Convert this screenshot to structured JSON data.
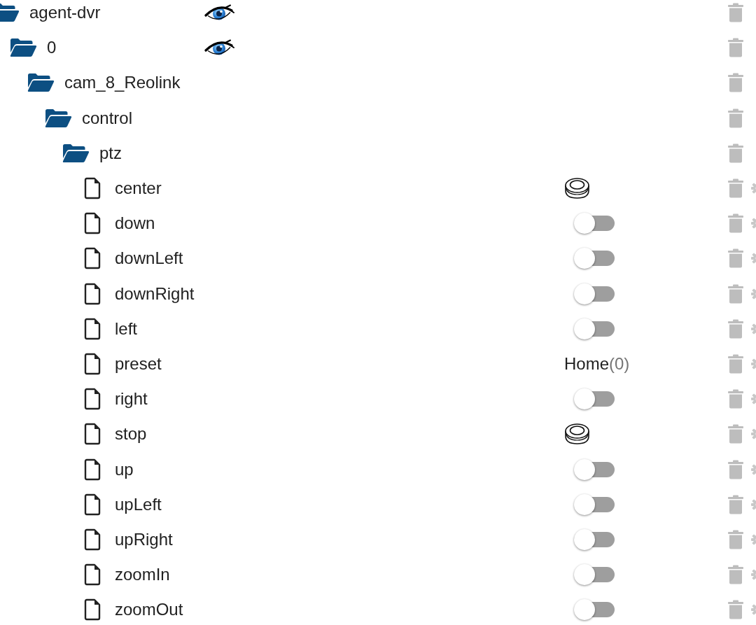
{
  "tree": [
    {
      "kind": "folder",
      "name": "agent-dvr",
      "expanded": true,
      "watched": true,
      "children": [
        {
          "kind": "folder",
          "name": "0",
          "expanded": true,
          "watched": true,
          "children": [
            {
              "kind": "folder",
              "name": "cam_8_Reolink",
              "expanded": true,
              "watched": false,
              "children": [
                {
                  "kind": "folder",
                  "name": "control",
                  "expanded": true,
                  "watched": false,
                  "children": [
                    {
                      "kind": "folder",
                      "name": "ptz",
                      "expanded": true,
                      "watched": false,
                      "children": [
                        {
                          "kind": "file",
                          "name": "center",
                          "control": {
                            "kind": "button"
                          }
                        },
                        {
                          "kind": "file",
                          "name": "down",
                          "control": {
                            "kind": "switch",
                            "checked": false
                          }
                        },
                        {
                          "kind": "file",
                          "name": "downLeft",
                          "control": {
                            "kind": "switch",
                            "checked": false
                          }
                        },
                        {
                          "kind": "file",
                          "name": "downRight",
                          "control": {
                            "kind": "switch",
                            "checked": false
                          }
                        },
                        {
                          "kind": "file",
                          "name": "left",
                          "control": {
                            "kind": "switch",
                            "checked": false
                          }
                        },
                        {
                          "kind": "file",
                          "name": "preset",
                          "control": {
                            "kind": "value",
                            "value": "Home",
                            "value_id": "(0)"
                          }
                        },
                        {
                          "kind": "file",
                          "name": "right",
                          "control": {
                            "kind": "switch",
                            "checked": false
                          }
                        },
                        {
                          "kind": "file",
                          "name": "stop",
                          "control": {
                            "kind": "button"
                          }
                        },
                        {
                          "kind": "file",
                          "name": "up",
                          "control": {
                            "kind": "switch",
                            "checked": false
                          }
                        },
                        {
                          "kind": "file",
                          "name": "upLeft",
                          "control": {
                            "kind": "switch",
                            "checked": false
                          }
                        },
                        {
                          "kind": "file",
                          "name": "upRight",
                          "control": {
                            "kind": "switch",
                            "checked": false
                          }
                        },
                        {
                          "kind": "file",
                          "name": "zoomIn",
                          "control": {
                            "kind": "switch",
                            "checked": false
                          }
                        },
                        {
                          "kind": "file",
                          "name": "zoomOut",
                          "control": {
                            "kind": "switch",
                            "checked": false
                          }
                        }
                      ]
                    }
                  ]
                }
              ]
            }
          ]
        }
      ]
    }
  ]
}
